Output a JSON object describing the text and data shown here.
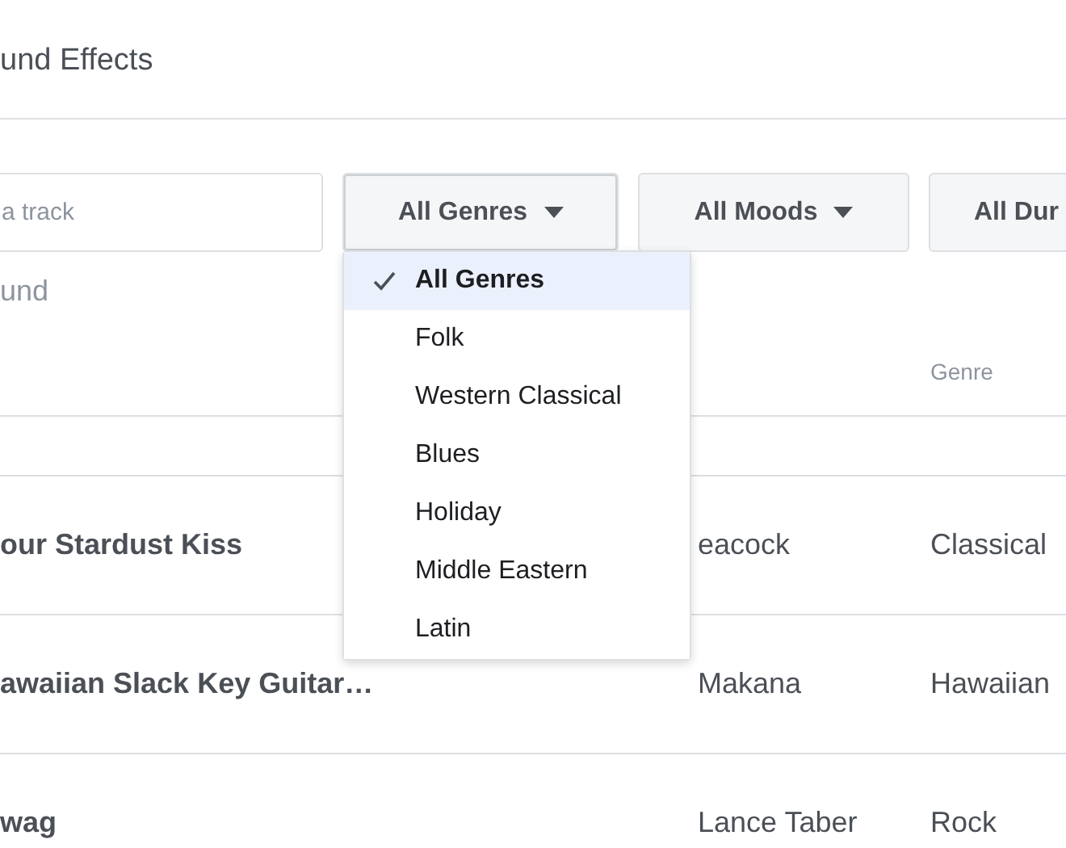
{
  "page_title": "und Effects",
  "search": {
    "placeholder": "a track"
  },
  "filters": [
    {
      "label": "All Genres",
      "caret": true,
      "expanded": true
    },
    {
      "label": "All Moods",
      "caret": true,
      "expanded": false
    },
    {
      "label": "All Dur",
      "caret": false,
      "expanded": false
    }
  ],
  "genre_menu": [
    {
      "label": "All Genres",
      "selected": true
    },
    {
      "label": "Folk",
      "selected": false
    },
    {
      "label": "Western Classical",
      "selected": false
    },
    {
      "label": "Blues",
      "selected": false
    },
    {
      "label": "Holiday",
      "selected": false
    },
    {
      "label": "Middle Eastern",
      "selected": false
    },
    {
      "label": "Latin",
      "selected": false
    }
  ],
  "result_count": "und",
  "table": {
    "genre_header": "Genre",
    "rows": [
      {
        "title": "our Stardust Kiss",
        "artist": "eacock",
        "genre": "Classical"
      },
      {
        "title": "awaiian Slack Key Guitar…",
        "artist": "Makana",
        "genre": "Hawaiian"
      },
      {
        "title": "wag",
        "artist": "Lance Taber",
        "genre": "Rock"
      }
    ]
  }
}
